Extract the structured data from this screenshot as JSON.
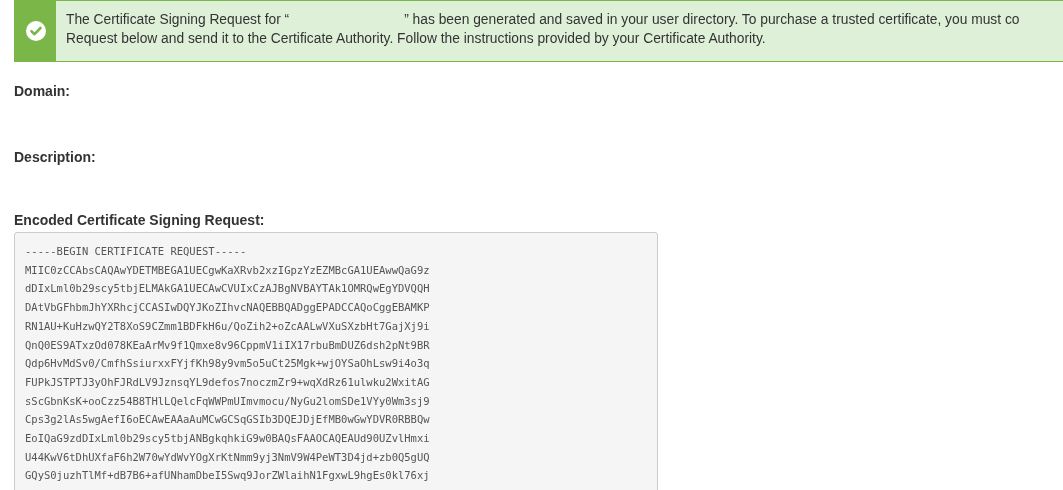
{
  "alert": {
    "kind": "success",
    "lines": [
      "The Certificate Signing Request for “                              ” has been generated and saved in your user directory. To purchase a trusted certificate, you must co",
      "Request below and send it to the Certificate Authority. Follow the instructions provided by your Certificate Authority."
    ]
  },
  "fields": [
    {
      "label": "Domain:"
    },
    {
      "label": "Description:"
    }
  ],
  "csr": {
    "label": "Encoded Certificate Signing Request:",
    "lines": [
      "-----BEGIN CERTIFICATE REQUEST-----",
      "MIIC0zCCAbsCAQAwYDETMBEGA1UECgwKaXRvb2xzIGpzYzEZMBcGA1UEAwwQaG9z",
      "dDIxLml0b29scy5tbjELMAkGA1UECAwCVUIxCzAJBgNVBAYTAk1OMRQwEgYDVQQH",
      "DAtVbGFhbmJhYXRhcjCCASIwDQYJKoZIhvcNAQEBBQADggEPADCCAQoCggEBAMKP",
      "RN1AU+KuHzwQY2T8XoS9CZmm1BDFkH6u/QoZih2+oZcAALwVXuSXzbHt7GajXj9i",
      "QnQ0ES9ATxzOd078KEaArMv9f1Qmxe8v96CppmV1iIX17rbuBmDUZ6dsh2pNt9BR",
      "Qdp6HvMdSv0/CmfhSsiurxxFYjfKh98y9vm5o5uCt25Mgk+wjOYSaOhLsw9i4o3q",
      "FUPkJSTPTJ3yOhFJRdLV9JznsqYL9defos7noczmZr9+wqXdRz61ulwku2WxitAG",
      "sScGbnKsK+ooCzz54B8THlLQelcFqWWPmUImvmocu/NyGu2lomSDe1VYy0Wm3sj9",
      "Cps3g2lAs5wgAefI6oECAwEAAaAuMCwGCSqGSIb3DQEJDjEfMB0wGwYDVR0RBBQw",
      "EoIQaG9zdDIxLml0b29scy5tbjANBgkqhkiG9w0BAQsFAAOCAQEAUd90UZvlHmxi",
      "U44KwV6tDhUXfaF6h2W70wYdWvYOgXrKtNmm9yj3NmV9W4PeWT3D4jd+zb0Q5gUQ",
      "GQyS0juzhTlMf+dB7B6+afUNhamDbeI5Swq9JorZWlaihN1FgxwL9hgEs0kl76xj"
    ]
  }
}
